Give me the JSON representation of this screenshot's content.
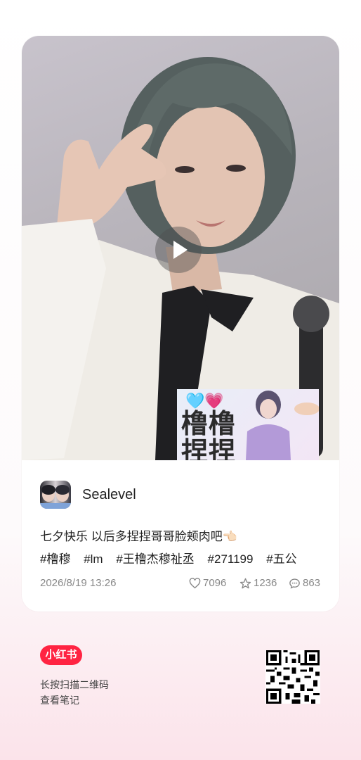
{
  "post": {
    "author": "Sealevel",
    "caption": "七夕快乐 以后多捏捏哥哥脸颊肉吧👈🏻",
    "tags": [
      "#橹穆",
      "#lm",
      "#王橹杰穆祉丞",
      "#271199",
      "#五公"
    ],
    "date": "2026/8/19 13:26",
    "likes": "7096",
    "favorites": "1236",
    "comments": "863"
  },
  "sticker": {
    "hearts": "🩵💗",
    "line1": "橹橹",
    "line2": "捏捏"
  },
  "footer": {
    "brand": "小红书",
    "line1": "长按扫描二维码",
    "line2": "查看笔记"
  },
  "icons": {
    "play": "play-icon",
    "like": "heart-icon",
    "favorite": "star-icon",
    "comment": "comment-icon"
  },
  "colors": {
    "brand": "#ff2442",
    "meta_text": "#888888"
  }
}
